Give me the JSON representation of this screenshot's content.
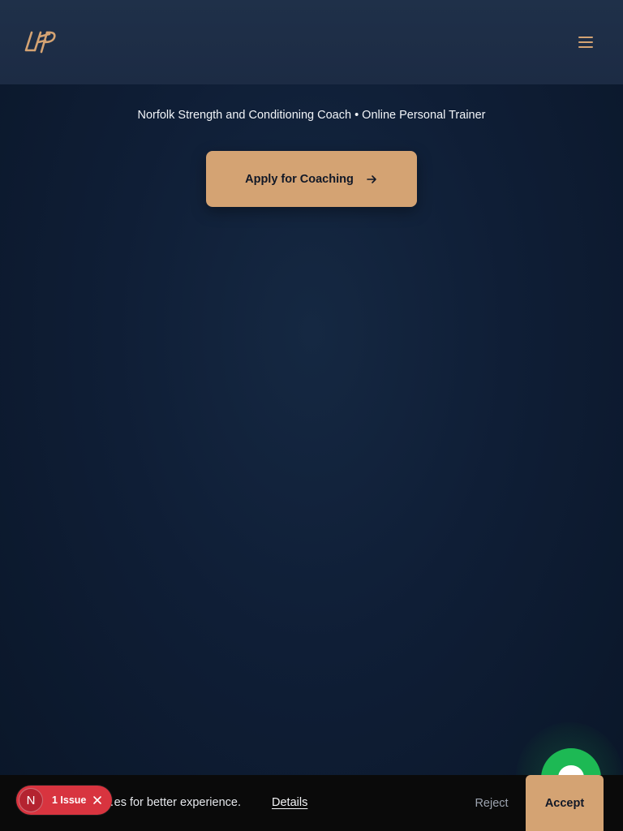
{
  "header": {
    "logo_text": "LFP",
    "menu_icon": "hamburger-menu-icon",
    "accent_color": "#d4a373"
  },
  "hero": {
    "title_faint": "",
    "subtitle": "Norfolk Strength and Conditioning Coach • Online Personal Trainer",
    "cta_label": "Apply for Coaching",
    "cta_icon": "arrow-right-icon",
    "cta_color": "#d4a373"
  },
  "chat_widget": {
    "icon": "chat-bubble-icon",
    "color": "#1db954"
  },
  "cookie_banner": {
    "message": "…es for better experience.",
    "details_label": "Details",
    "reject_label": "Reject",
    "accept_label": "Accept"
  },
  "dev_badge": {
    "logo_letter": "N",
    "issues_label": "1 Issue",
    "close_icon": "close-icon",
    "color": "#d8343f"
  }
}
